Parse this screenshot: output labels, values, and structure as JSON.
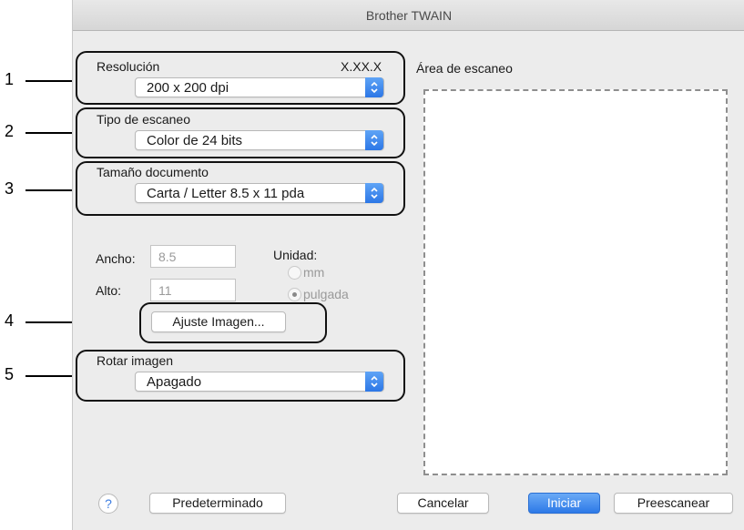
{
  "window": {
    "title": "Brother TWAIN"
  },
  "callouts": [
    "1",
    "2",
    "3",
    "4",
    "5"
  ],
  "resolution": {
    "label": "Resolución",
    "version": "X.XX.X",
    "value": "200 x 200 dpi"
  },
  "scan_type": {
    "label": "Tipo de escaneo",
    "value": "Color de 24 bits"
  },
  "doc_size": {
    "label": "Tamaño documento",
    "value": "Carta / Letter  8.5 x 11 pda"
  },
  "dimensions": {
    "width_label": "Ancho:",
    "width_value": "8.5",
    "height_label": "Alto:",
    "height_value": "11"
  },
  "unit": {
    "label": "Unidad:",
    "options": [
      {
        "label": "mm",
        "selected": false
      },
      {
        "label": "pulgada",
        "selected": true
      }
    ]
  },
  "image_adjust": {
    "label": "Ajuste Imagen..."
  },
  "rotate": {
    "label": "Rotar imagen",
    "value": "Apagado"
  },
  "scan_area": {
    "label": "Área de escaneo"
  },
  "footer": {
    "help": "?",
    "default": "Predeterminado",
    "cancel": "Cancelar",
    "start": "Iniciar",
    "prescan": "Preescanear"
  },
  "colors": {
    "accent": "#2d79e7",
    "window_bg": "#ececec",
    "callout": "#000000"
  }
}
